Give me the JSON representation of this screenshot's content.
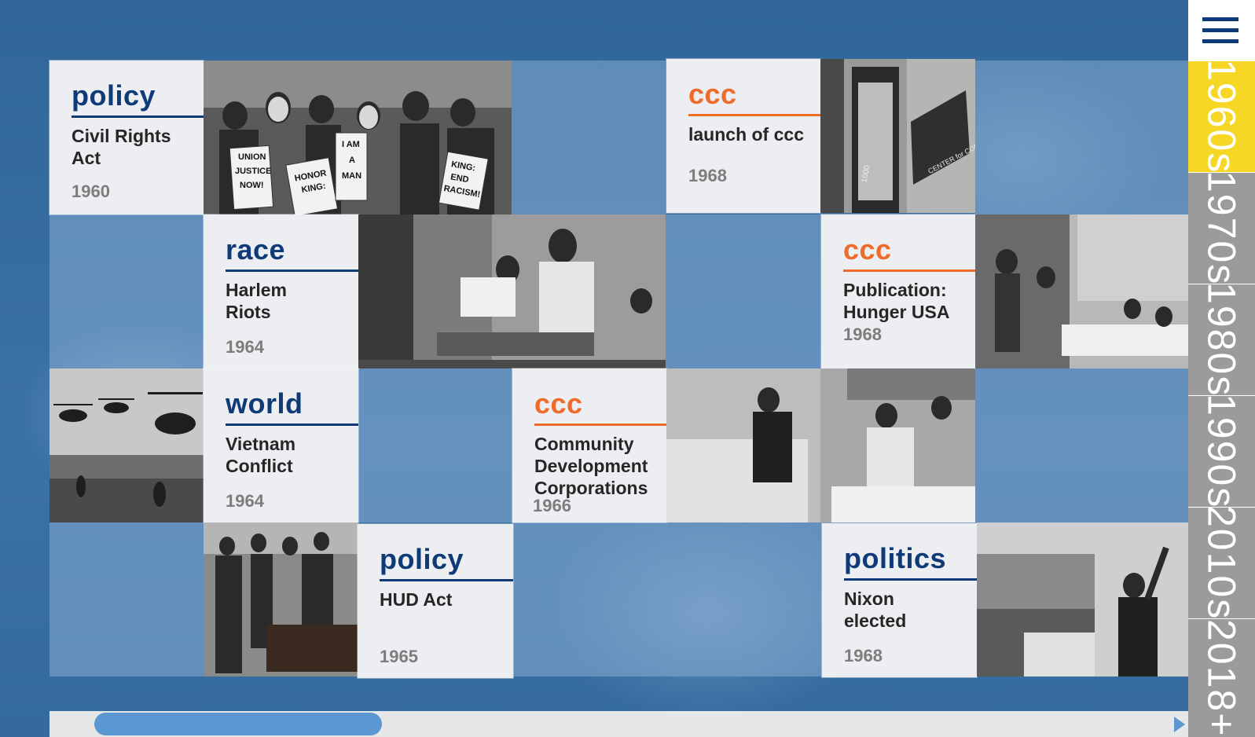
{
  "menu": {
    "icon": "hamburger-menu-icon"
  },
  "decades": [
    {
      "label": "1960s",
      "active": true
    },
    {
      "label": "1970s",
      "active": false
    },
    {
      "label": "1980s",
      "active": false
    },
    {
      "label": "1990s",
      "active": false
    },
    {
      "label": "2010s",
      "active": false
    },
    {
      "label": "2018+",
      "active": false
    }
  ],
  "colors": {
    "navy": "#0f3a78",
    "orange": "#ee6b2a",
    "active_decade": "#f6d726",
    "inactive_decade": "#9b9b9b",
    "scroll_thumb": "#5b97d3"
  },
  "cards": {
    "civil_rights": {
      "category": "policy",
      "title": "Civil Rights Act",
      "year": "1960"
    },
    "launch_ccc": {
      "category": "ccc",
      "title": "launch of ccc",
      "year": "1968"
    },
    "harlem": {
      "category": "race",
      "title": "Harlem Riots",
      "year": "1964"
    },
    "hunger": {
      "category": "ccc",
      "title": "Publication: Hunger USA",
      "year": "1968"
    },
    "vietnam": {
      "category": "world",
      "title": "Vietnam Conflict",
      "year": "1964"
    },
    "cdc": {
      "category": "ccc",
      "title": "Community Development Corporations",
      "year": "1966"
    },
    "hud": {
      "category": "policy",
      "title": "HUD Act",
      "year": "1965"
    },
    "nixon": {
      "category": "politics",
      "title": "Nixon elected",
      "year": "1968"
    }
  },
  "photos": {
    "protest_signs": [
      "UNION JUSTICE NOW!",
      "HONOR KING: END RACISM!",
      "I AM A MAN",
      "KING: END RACISM!"
    ],
    "office_sign": "CENTER for COMMUNITY CHANGE",
    "door_number": "1000"
  }
}
